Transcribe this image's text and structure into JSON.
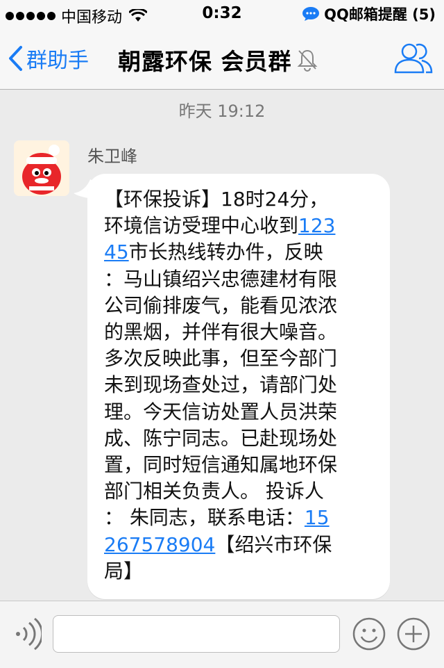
{
  "status_bar": {
    "carrier": "中国移动",
    "time": "0:32",
    "notification": "QQ邮箱提醒 (5)"
  },
  "nav": {
    "back_label": "群助手",
    "title": "朝露环保 会员群"
  },
  "chat": {
    "timestamp": "昨天 19:12",
    "sender": "朱卫峰",
    "message": {
      "part1": "【环保投诉】18时24分，\n环境信访受理中心收到",
      "link1a": "123",
      "link1b": "45",
      "part2": "市长热线转办件，反映\n：马山镇绍兴忠德建材有限\n公司偷排废气，能看见浓浓\n的黑烟，并伴有很大噪音。\n多次反映此事，但至今部门\n未到现场查处过，请部门处\n理。今天信访处置人员洪荣\n成、陈宁同志。已赴现场处\n置，同时短信通知属地环保\n部门相关负责人。 投诉人\n：  朱同志，联系电话：",
      "link2a": "15",
      "link2b": "267578904",
      "part3": "【绍兴市环保\n局】"
    }
  },
  "input_bar": {
    "placeholder": ""
  },
  "colors": {
    "accent": "#1a7cf5",
    "background": "#ebebeb",
    "bubble": "#ffffff"
  }
}
